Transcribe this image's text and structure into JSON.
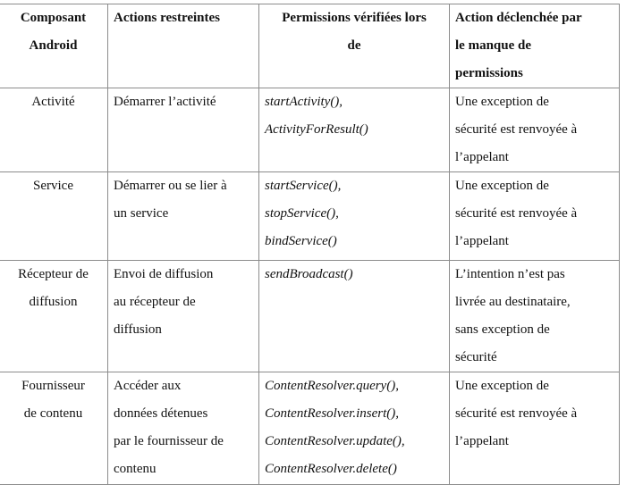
{
  "table": {
    "headers": [
      [
        "Composant",
        "Android"
      ],
      [
        "Actions restreintes"
      ],
      [
        "Permissions vérifiées lors",
        "de"
      ],
      [
        "Action déclenchée par",
        "le manque de",
        "permissions"
      ]
    ],
    "rows": [
      {
        "component": [
          "Activité"
        ],
        "restricted_actions": [
          "Démarrer l’activité"
        ],
        "checked_at": [
          "startActivity(),",
          "ActivityForResult()"
        ],
        "action_on_missing": [
          "Une exception de",
          "sécurité est renvoyée à",
          "l’appelant"
        ]
      },
      {
        "component": [
          "Service"
        ],
        "restricted_actions": [
          "Démarrer ou se lier à",
          "un service"
        ],
        "checked_at": [
          "startService(),",
          "stopService(),",
          "bindService()"
        ],
        "action_on_missing": [
          "Une exception de",
          "sécurité est renvoyée à",
          "l’appelant"
        ]
      },
      {
        "component": [
          "Récepteur de",
          "diffusion"
        ],
        "restricted_actions": [
          "Envoi de diffusion",
          "au récepteur de",
          "diffusion"
        ],
        "checked_at": [
          "sendBroadcast()"
        ],
        "action_on_missing": [
          "L’intention n’est pas",
          "livrée au destinataire,",
          "sans exception de",
          "sécurité"
        ]
      },
      {
        "component": [
          "Fournisseur",
          "de contenu"
        ],
        "restricted_actions": [
          "Accéder aux",
          "données détenues",
          "par le fournisseur de",
          "contenu"
        ],
        "checked_at": [
          "ContentResolver.query(),",
          "ContentResolver.insert(),",
          "ContentResolver.update(),",
          "ContentResolver.delete()"
        ],
        "action_on_missing": [
          "Une exception de",
          "sécurité est renvoyée à",
          "l’appelant"
        ]
      }
    ]
  }
}
